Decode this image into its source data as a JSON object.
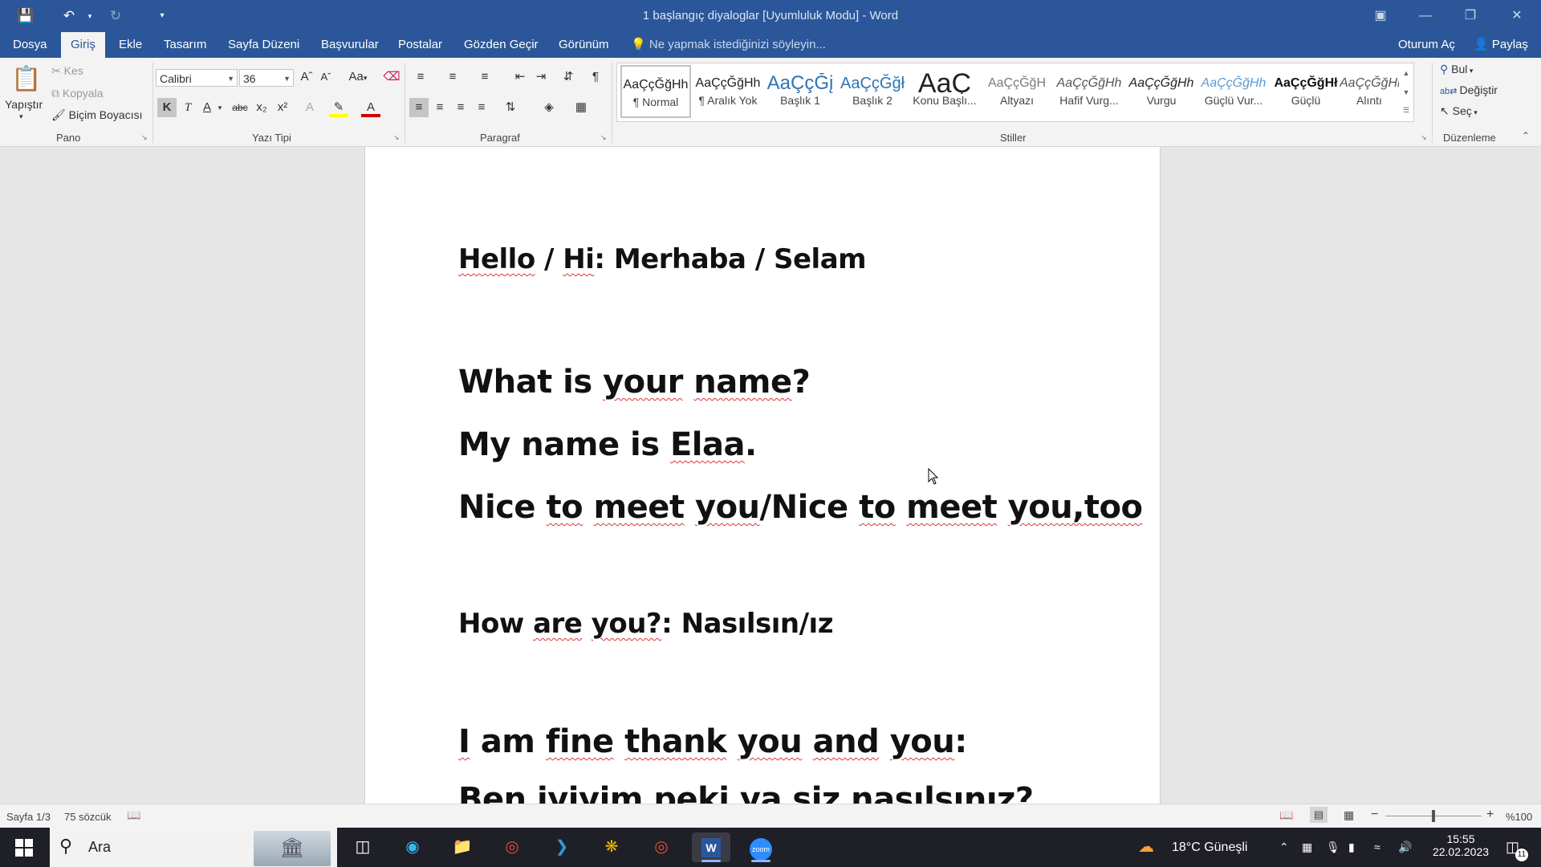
{
  "titlebar": {
    "title": "1 başlangıç diyaloglar [Uyumluluk Modu] - Word"
  },
  "tabs": [
    "Dosya",
    "Giriş",
    "Ekle",
    "Tasarım",
    "Sayfa Düzeni",
    "Başvurular",
    "Postalar",
    "Gözden Geçir",
    "Görünüm"
  ],
  "active_tab": "Giriş",
  "tell_me": "Ne yapmak istediğinizi söyleyin...",
  "account": {
    "signin": "Oturum Aç",
    "share": "Paylaş"
  },
  "clipboard": {
    "paste": "Yapıştır",
    "cut": "Kes",
    "copy": "Kopyala",
    "format_painter": "Biçim Boyacısı",
    "label": "Pano"
  },
  "font": {
    "name": "Calibri",
    "size": "36",
    "case": "Aa",
    "bold": "K",
    "italic": "T",
    "underline": "A",
    "strike": "abc",
    "sub": "x₂",
    "sup": "x²",
    "label": "Yazı Tipi"
  },
  "paragraph": {
    "label": "Paragraf",
    "pilcrow": "¶"
  },
  "styles": {
    "label": "Stiller",
    "items": [
      {
        "preview": "AaÇçĞğHh",
        "name": "¶ Normal",
        "color": "#222222"
      },
      {
        "preview": "AaÇçĞğHh",
        "name": "¶ Aralık Yok",
        "color": "#222222"
      },
      {
        "preview": "AaÇçĞį",
        "name": "Başlık 1",
        "color": "#2e74b5"
      },
      {
        "preview": "AaÇçĞğł",
        "name": "Başlık 2",
        "color": "#2e74b5"
      },
      {
        "preview": "AaÇ",
        "name": "Konu Başlı...",
        "color": "#222222"
      },
      {
        "preview": "AaÇçĞğH",
        "name": "Altyazı",
        "color": "#7a7a7a"
      },
      {
        "preview": "AaÇçĞğHh",
        "name": "Hafif Vurg...",
        "color": "#555555"
      },
      {
        "preview": "AaÇçĞğHh",
        "name": "Vurgu",
        "color": "#222222"
      },
      {
        "preview": "AaÇçĞğHh",
        "name": "Güçlü Vur...",
        "color": "#5b9bd5"
      },
      {
        "preview": "AaÇçĞğHł",
        "name": "Güçlü",
        "color": "#111111"
      },
      {
        "preview": "AaÇçĞğHh",
        "name": "Alıntı",
        "color": "#555555"
      }
    ]
  },
  "editing": {
    "find": "Bul",
    "replace": "Değiştir",
    "select": "Seç",
    "label": "Düzenleme"
  },
  "document": {
    "p1": {
      "a": "Hello",
      "b": " / ",
      "c": "Hi",
      "d": ": Merhaba / Selam"
    },
    "p2": {
      "a": "What is ",
      "b": "your",
      "c": " ",
      "d": "name",
      "e": "?"
    },
    "p3": {
      "a": " My name is ",
      "b": "Elaa",
      "c": "."
    },
    "p4": {
      "a": " Nice ",
      "b": "to",
      "c": " ",
      "d": "meet",
      "e": " ",
      "f": "you",
      "g": "/Nice ",
      "h": "to",
      "i": " ",
      "j": "meet",
      "k": " ",
      "l": "you,too"
    },
    "p5": {
      "a": "How ",
      "b": "are",
      "c": " ",
      "d": "you?",
      "e": ": Nasılsın/ız"
    },
    "p6": {
      "a": "I",
      "b": " am ",
      "c": "fine",
      "d": " ",
      "e": "thank",
      "f": " ",
      "g": "you",
      "h": " ",
      "i": "and",
      "j": " ",
      "k": "you",
      "l": ":"
    },
    "p7": "Ben iyiyim peki ya siz nasılsınız?"
  },
  "statusbar": {
    "page": "Sayfa 1/3",
    "words": "75 sözcük",
    "zoom": "%100",
    "zoom_fraction": 0.5
  },
  "taskbar": {
    "search": "Ara",
    "weather": "18°C  Güneşli",
    "time": "15:55",
    "date": "22.02.2023",
    "notifications": "11"
  },
  "colors": {
    "accent": "#2b579a",
    "highlight": "#ffff00",
    "font_color": "#d00000",
    "spell_underline": "#dd3333"
  }
}
